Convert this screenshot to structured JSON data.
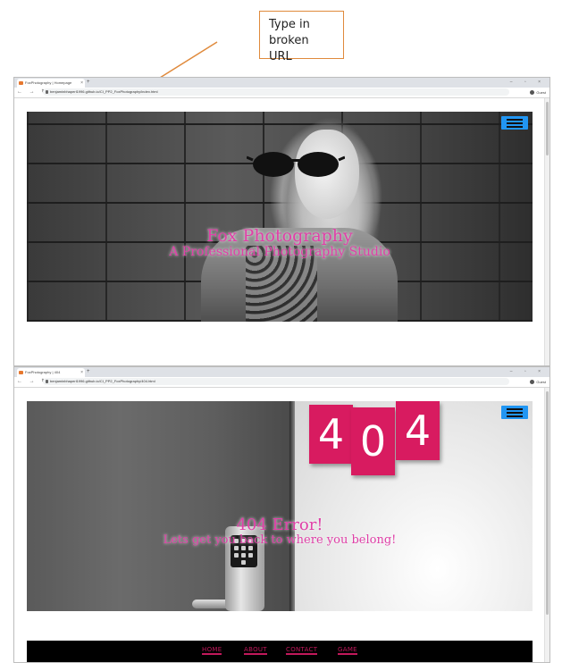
{
  "annotation": {
    "text_line1": "Type in",
    "text_line2": "broken URL",
    "border_color": "#e08a3c"
  },
  "window1": {
    "tab_title": "FoxPhotography | Homepage",
    "url": "benjaminbhaperl1996.github.io/CI_PP2_FoxPhotography/index.html",
    "profile": "Guest",
    "hero": {
      "title": "Fox Photography",
      "subtitle": "A Professional Photography Studio"
    }
  },
  "window2": {
    "tab_title": "FoxPhotography | 404",
    "url": "benjaminbhaperl1996.github.io/CI_PP2_FoxPhotography/404.html",
    "profile": "Guest",
    "hero": {
      "digits": [
        "4",
        "0",
        "4"
      ],
      "title": "404 Error!",
      "subtitle": "Lets get you back to where you belong!"
    },
    "footer_nav": [
      "HOME",
      "ABOUT",
      "CONTACT",
      "GAME"
    ]
  },
  "colors": {
    "accent_pink": "#e040a8",
    "card_pink": "#d81b60",
    "menu_blue": "#2196f3"
  },
  "icons": [
    "favicon-fox-icon",
    "new-tab-icon",
    "back-icon",
    "forward-icon",
    "reload-icon",
    "lock-icon",
    "avatar-icon",
    "hamburger-menu-icon"
  ]
}
